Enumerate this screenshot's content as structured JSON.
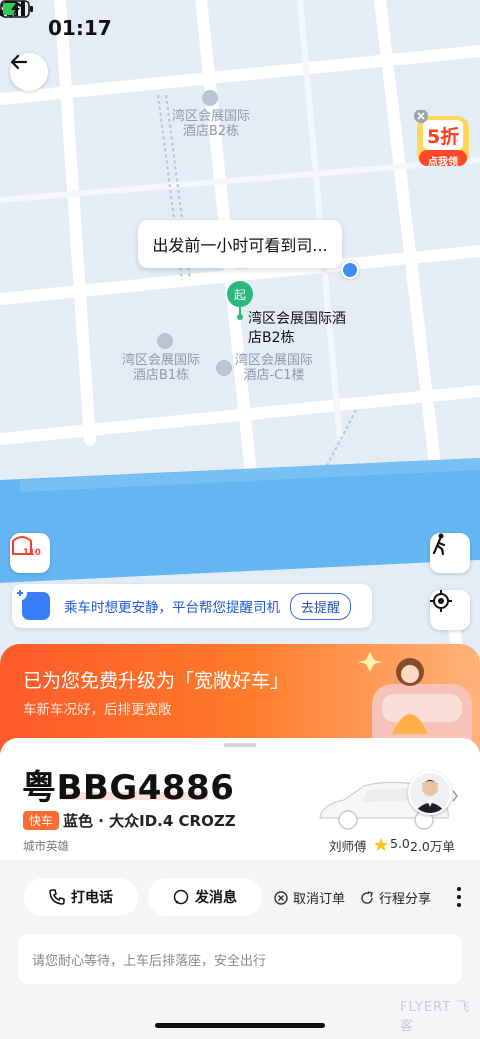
{
  "status_bar": {
    "time": "01:17"
  },
  "map": {
    "labels": [
      "湾区会展国际",
      "酒店B2栋",
      "湾区会展国际",
      "酒店B1栋",
      "湾区会展国际",
      "酒店-C1楼"
    ],
    "callout": "出发前一小时可看到司...",
    "pickup_marker": "起",
    "pickup_name_line1": "湾区会展国际酒",
    "pickup_name_line2": "店B2栋",
    "police_badge": "110",
    "ad_badge": "5折",
    "ad_label": "点我领"
  },
  "safety_bar": {
    "text": "乘车时想更安静，平台帮您提醒司机",
    "button": "去提醒"
  },
  "upgrade_banner": {
    "title": "已为您免费升级为「宽敞好车」",
    "subtitle": "车新车况好，后排更宽敞"
  },
  "driver_card": {
    "plate": "粤BBG4886",
    "badge": "快车",
    "car": "蓝色 · 大众ID.4 CROZZ",
    "city": "城市英雄",
    "driver_name": "刘师傅",
    "rating": "5.0",
    "orders": "2.0万单"
  },
  "actions": {
    "call": "打电话",
    "message": "发消息",
    "cancel": "取消订单",
    "share": "行程分享"
  },
  "message_hint": "请您耐心等待，上车后排落座，安全出行",
  "watermark": "FLYERT 飞客",
  "colors": {
    "accent_orange": "#ff6a30",
    "accent_blue": "#3a7ef7",
    "pickup_green": "#2bb87d",
    "river": "#64b6f2"
  }
}
